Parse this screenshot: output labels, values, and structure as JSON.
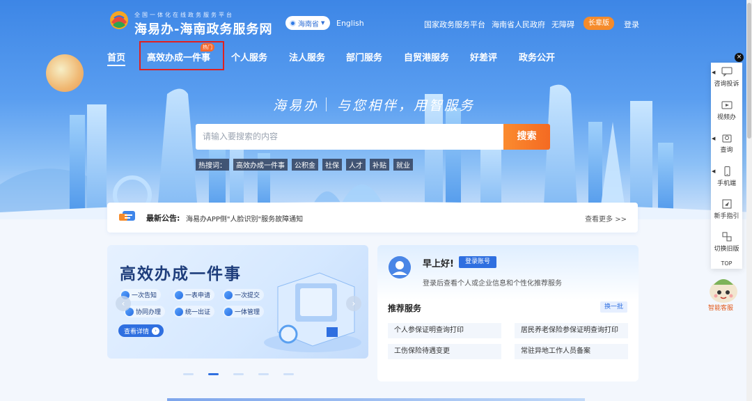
{
  "header": {
    "site_subtitle": "全国一体化在线政务服务平台",
    "site_name": "海易办-海南政务服务网",
    "region": "海南省",
    "english": "English",
    "links": [
      "国家政务服务平台",
      "海南省人民政府",
      "无障碍"
    ],
    "elder_mode": "长辈版",
    "login": "登录"
  },
  "nav": {
    "items": [
      "首页",
      "高效办成一件事",
      "个人服务",
      "法人服务",
      "部门服务",
      "自贸港服务",
      "好差评",
      "政务公开"
    ],
    "hot_badge": "热门"
  },
  "hero": {
    "slogan_left": "海易办",
    "slogan_right": "与您相伴，用智服务"
  },
  "search": {
    "placeholder": "请输入要搜索的内容",
    "button": "搜索",
    "hot_label": "热搜词：",
    "hot_words": [
      "高效办成一件事",
      "公积金",
      "社保",
      "人才",
      "补贴",
      "就业"
    ]
  },
  "notice": {
    "title": "最新公告:",
    "text": "海易办APP侧\"人脸识别\"服务故障通知",
    "more": "查看更多 >>"
  },
  "banner": {
    "title": "高效办成一件事",
    "features": [
      "一次告知",
      "一表申请",
      "一次提交",
      "协同办理",
      "统一出证",
      "一体管理"
    ],
    "detail": "查看详情"
  },
  "user_panel": {
    "greeting": "早上好!",
    "login_account": "登录账号",
    "hint": "登录后查看个人或企业信息和个性化推荐服务",
    "rec_title": "推荐服务",
    "refresh": "换一批",
    "rec_items": [
      "个人参保证明查询打印",
      "居民养老保险参保证明查询打印",
      "工伤保险待遇变更",
      "常驻异地工作人员备案"
    ]
  },
  "side_toolbar": {
    "items": [
      "咨询投诉",
      "视频办",
      "查询",
      "手机端",
      "新手指引",
      "切换旧版"
    ],
    "top": "TOP",
    "close": "×"
  },
  "assistant": {
    "label": "智能客服"
  },
  "colors": {
    "primary": "#2f6fe0",
    "orange": "#f46a22",
    "highlight_box": "#e02020"
  }
}
